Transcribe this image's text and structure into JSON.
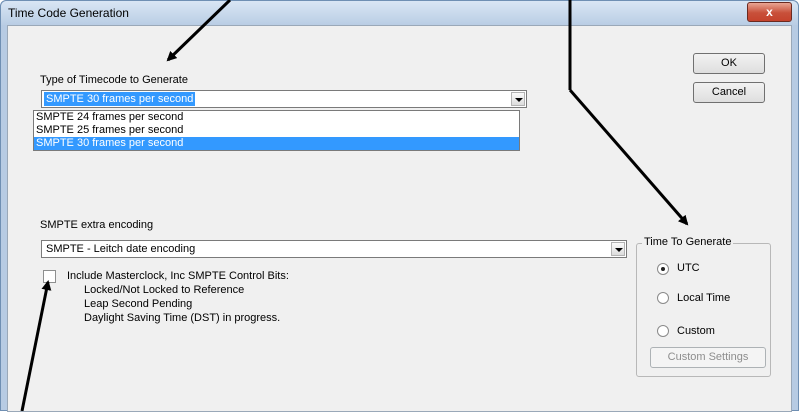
{
  "window": {
    "title": "Time Code Generation",
    "close_label": "x"
  },
  "timecode": {
    "label": "Type of Timecode to Generate",
    "selected": "SMPTE 30 frames per second",
    "options": [
      "SMPTE 24 frames per second",
      "SMPTE 25 frames per second",
      "SMPTE 30 frames per second"
    ]
  },
  "buttons": {
    "ok": "OK",
    "cancel": "Cancel"
  },
  "extra": {
    "label": "SMPTE extra encoding",
    "selected": "SMPTE - Leitch date encoding"
  },
  "control_bits": {
    "label": "Include Masterclock, Inc SMPTE Control Bits:",
    "items": [
      "Locked/Not Locked to Reference",
      "Leap Second Pending",
      "Daylight Saving Time (DST) in progress."
    ],
    "checked": false
  },
  "time_group": {
    "label": "Time To Generate",
    "utc": "UTC",
    "local": "Local Time",
    "custom": "Custom",
    "custom_settings": "Custom Settings",
    "selected": "UTC"
  }
}
